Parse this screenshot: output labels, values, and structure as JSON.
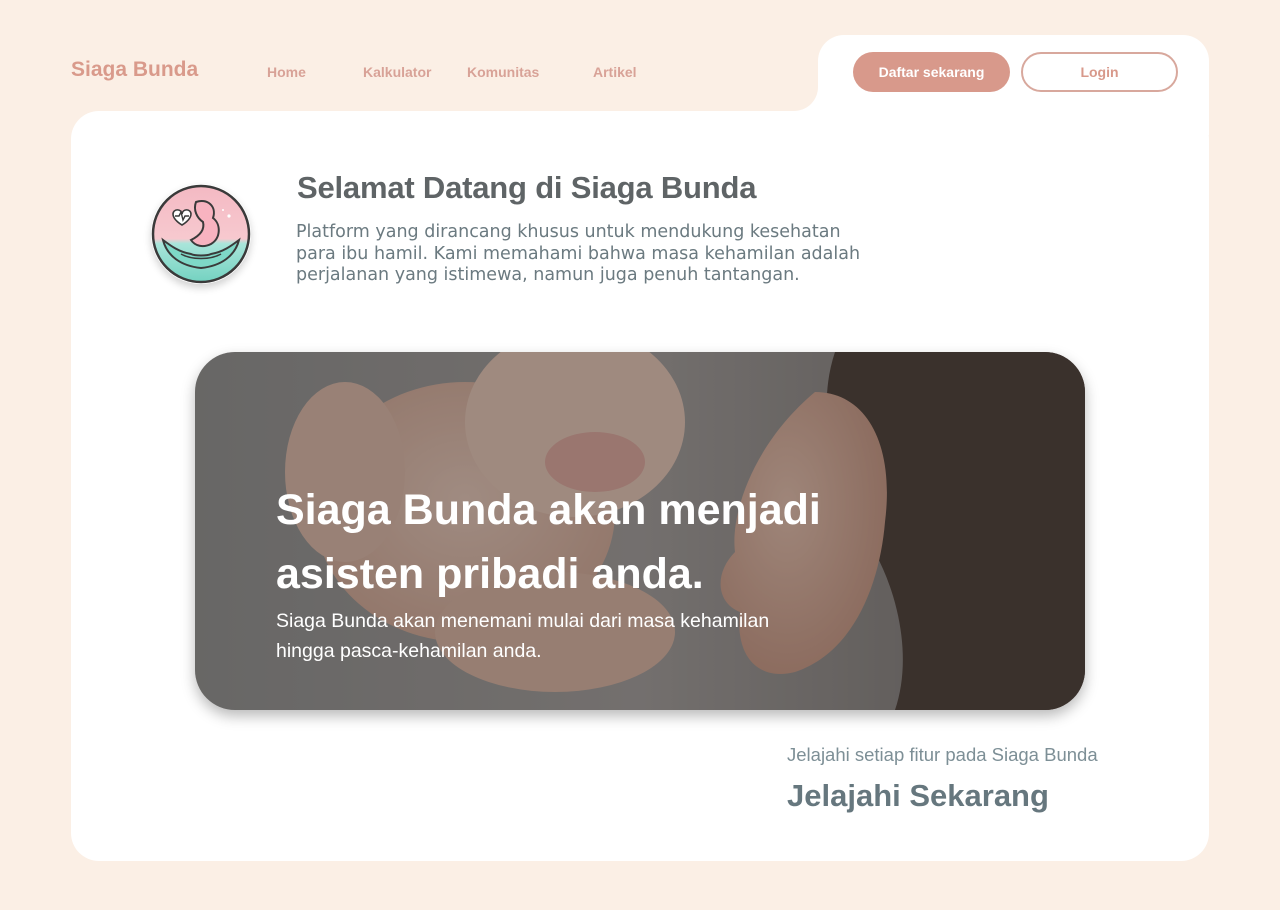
{
  "nav": {
    "brand": "Siaga Bunda",
    "links": [
      "Home",
      "Kalkulator",
      "Komunitas",
      "Artikel"
    ],
    "register_label": "Daftar sekarang",
    "login_label": "Login"
  },
  "welcome": {
    "title": "Selamat Datang di Siaga Bunda",
    "body": "Platform yang dirancang khusus untuk mendukung kesehatan para ibu hamil. Kami memahami bahwa masa kehamilan adalah perjalanan yang istimewa, namun juga penuh tantangan."
  },
  "hero": {
    "title": "Siaga Bunda akan menjadi asisten pribadi anda.",
    "subtitle": "Siaga Bunda akan menemani mulai dari masa kehamilan hingga pasca-kehamilan anda.",
    "image": "mother-and-baby-photo"
  },
  "explore": {
    "subtitle": "Jelajahi setiap fitur pada Siaga Bunda",
    "cta": "Jelajahi Sekarang"
  },
  "colors": {
    "background": "#fbefe5",
    "card": "#ffffff",
    "brand": "#d99a8b",
    "heading": "#5f6466",
    "body_text": "#6b7a80"
  }
}
